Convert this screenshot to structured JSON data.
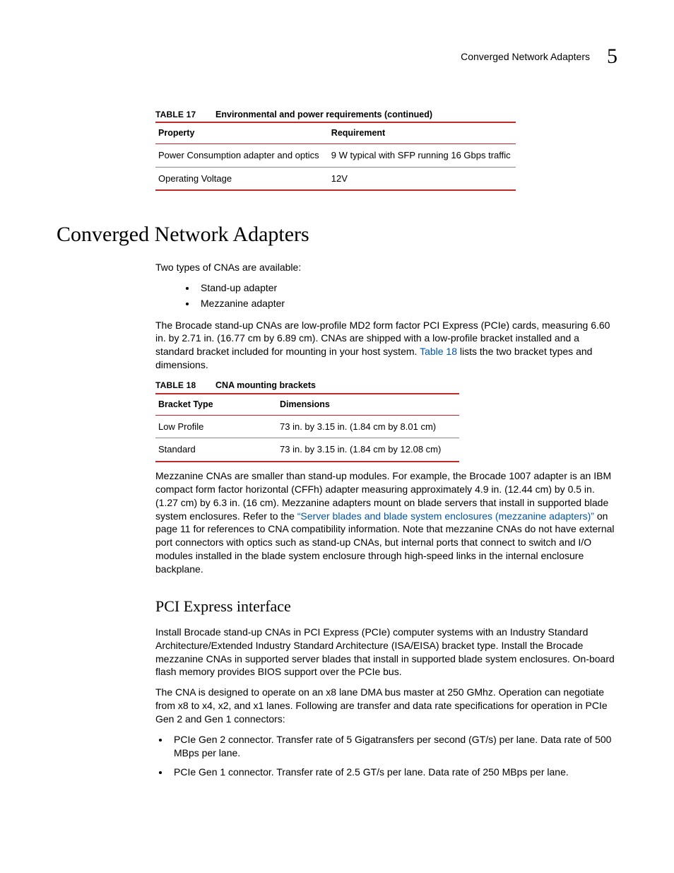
{
  "header": {
    "running_title": "Converged Network Adapters",
    "chapter_number": "5"
  },
  "table17": {
    "label": "TABLE 17",
    "title": "Environmental and power requirements  (continued)",
    "columns": [
      "Property",
      "Requirement"
    ],
    "rows": [
      {
        "c0": "Power Consumption adapter and optics",
        "c1": "9 W typical with SFP running 16 Gbps traffic"
      },
      {
        "c0": "Operating Voltage",
        "c1": "12V"
      }
    ]
  },
  "section": {
    "heading": "Converged Network Adapters",
    "intro": "Two types of CNAs are available:",
    "types": [
      "Stand-up adapter",
      "Mezzanine adapter"
    ],
    "para2_a": "The Brocade stand-up CNAs are low-profile MD2 form factor PCI Express (PCIe) cards, measuring 6.60 in. by 2.71 in. (16.77 cm by 6.89 cm). CNAs are shipped with a low-profile bracket installed and a standard bracket included for mounting in your host system. ",
    "para2_link": "Table 18",
    "para2_b": " lists the two bracket types and dimensions."
  },
  "table18": {
    "label": "TABLE 18",
    "title": "CNA mounting brackets",
    "columns": [
      "Bracket Type",
      "Dimensions"
    ],
    "rows": [
      {
        "c0": "Low Profile",
        "c1": "73 in. by 3.15 in. (1.84 cm by 8.01 cm)"
      },
      {
        "c0": "Standard",
        "c1": "73 in. by 3.15 in. (1.84 cm by 12.08 cm)"
      }
    ]
  },
  "mezz": {
    "a": "Mezzanine CNAs are smaller than stand-up modules. For example, the Brocade 1007 adapter is an IBM compact form factor horizontal (CFFh) adapter measuring approximately 4.9 in. (12.44 cm) by 0.5 in. (1.27 cm) by 6.3 in. (16 cm). Mezzanine adapters mount on blade servers that install in supported blade system enclosures. Refer to the ",
    "link": "“Server blades and blade system enclosures (mezzanine adapters)”",
    "b": " on page 11 for references to CNA compatibility information. Note that mezzanine CNAs do not have external port connectors with optics such as stand-up CNAs, but internal ports that connect to switch and I/O modules installed in the blade system enclosure through high-speed links in the internal enclosure backplane."
  },
  "pcie": {
    "heading": "PCI Express interface",
    "p1": "Install Brocade stand-up CNAs in PCI Express (PCIe) computer systems with an Industry Standard Architecture/Extended Industry Standard Architecture (ISA/EISA) bracket type. Install the Brocade mezzanine CNAs in supported server blades that install in supported blade system enclosures. On-board flash memory provides BIOS support over the PCIe bus.",
    "p2": "The CNA is designed to operate on an x8 lane DMA bus master at 250 GMhz. Operation can negotiate from x8 to x4, x2, and x1 lanes. Following are transfer and data rate specifications for operation in PCIe Gen 2 and Gen 1 connectors:",
    "bullets": [
      "PCIe Gen 2 connector. Transfer rate of 5 Gigatransfers per second (GT/s) per lane. Data rate of 500 MBps per lane.",
      "PCIe Gen 1 connector. Transfer rate of 2.5 GT/s per lane. Data rate of 250 MBps per lane."
    ]
  }
}
